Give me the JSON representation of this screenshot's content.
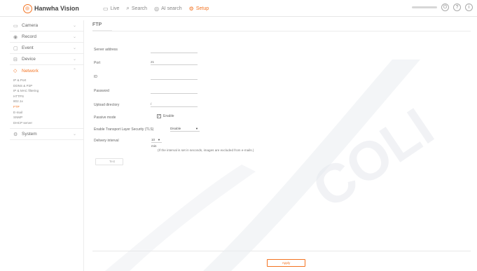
{
  "header": {
    "logo_text": "Hanwha Vision",
    "nav": [
      {
        "label": "Live",
        "icon": "monitor-icon"
      },
      {
        "label": "Search",
        "icon": "search-icon"
      },
      {
        "label": "AI search",
        "icon": "ai-search-icon"
      },
      {
        "label": "Setup",
        "icon": "gear-icon"
      }
    ],
    "active_nav": "Setup",
    "accent_color": "#f37321"
  },
  "sidebar": {
    "items": [
      {
        "label": "Camera",
        "icon": "camera-icon"
      },
      {
        "label": "Record",
        "icon": "record-icon"
      },
      {
        "label": "Event",
        "icon": "event-icon"
      },
      {
        "label": "Device",
        "icon": "device-icon"
      },
      {
        "label": "Network",
        "icon": "network-icon"
      },
      {
        "label": "System",
        "icon": "system-icon"
      }
    ],
    "network_submenu": [
      "IP & Port",
      "DDNS & P2P",
      "IP & MAC filtering",
      "HTTPS",
      "802.1x",
      "FTP",
      "E-mail",
      "SNMP",
      "DHCP server"
    ],
    "active_submenu": "FTP"
  },
  "page": {
    "tab": "FTP",
    "fields": {
      "server_address_label": "Server address",
      "server_address_value": "",
      "port_label": "Port",
      "port_value": "21",
      "id_label": "ID",
      "id_value": "",
      "password_label": "Password",
      "password_value": "",
      "upload_directory_label": "Upload directory",
      "upload_directory_value": "/",
      "passive_mode_label": "Passive mode",
      "passive_mode_checkbox_label": "Enable",
      "passive_mode_checked": true,
      "tls_label": "Enable Transport Layer Security (TLS)",
      "tls_value": "Disable",
      "delivery_interval_label": "Delivery interval",
      "delivery_interval_value": "10 min",
      "delivery_note": "(If the interval is set in seconds, images are excluded from e-mails.)"
    },
    "test_button": "Test",
    "apply_button": "Apply"
  }
}
